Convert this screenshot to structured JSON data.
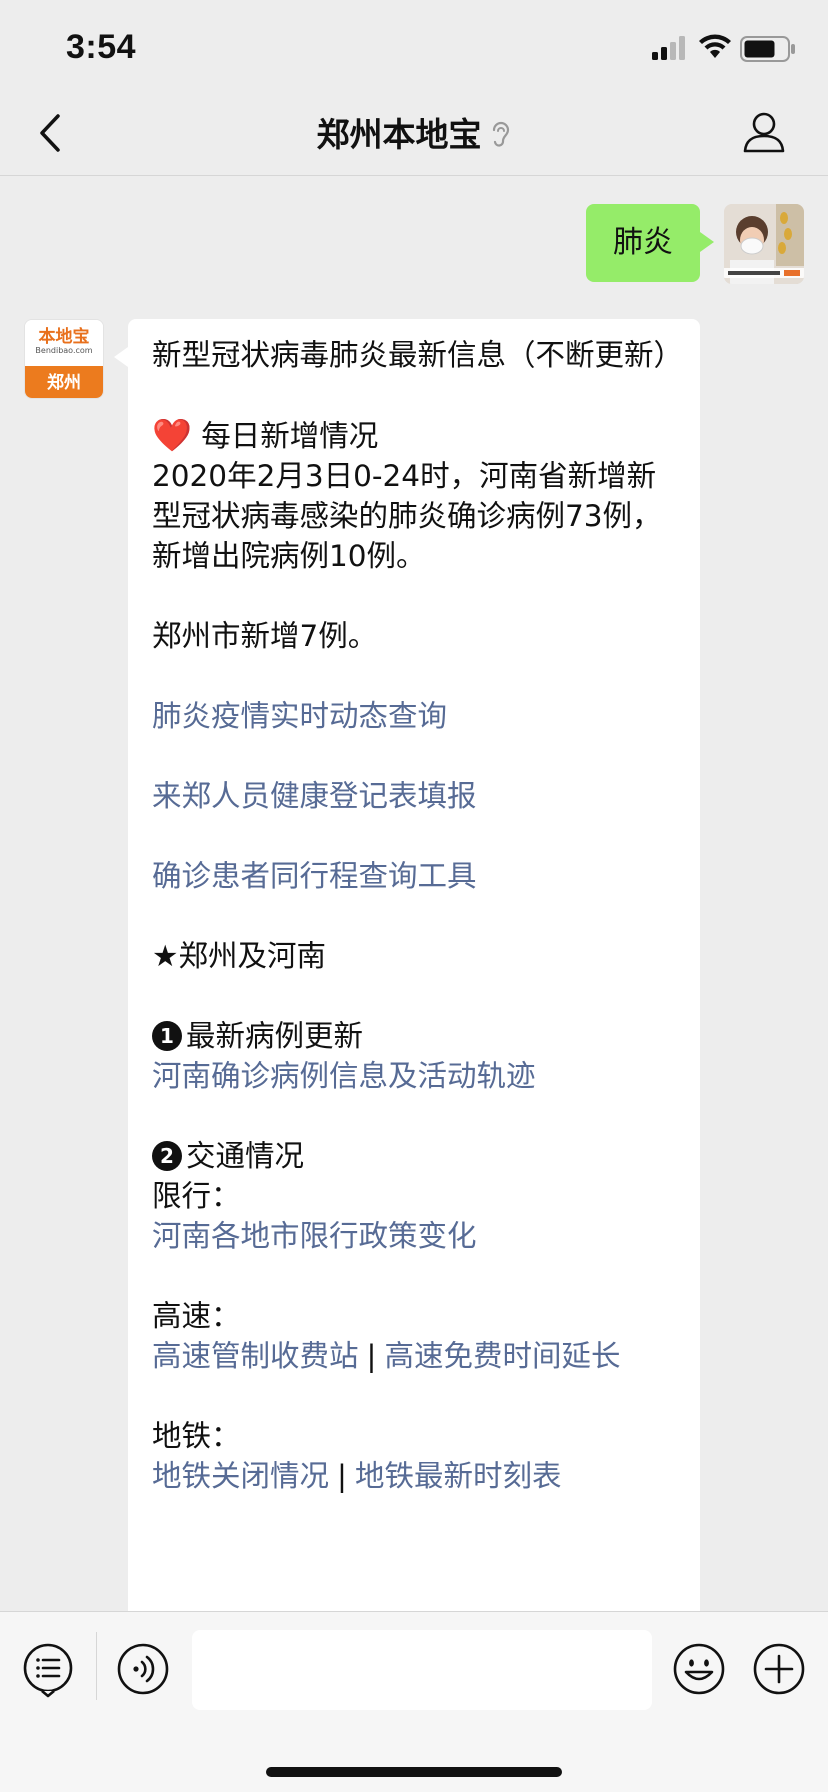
{
  "status_bar": {
    "time": "3:54"
  },
  "nav": {
    "title": "郑州本地宝"
  },
  "messages": {
    "user_text": "肺炎",
    "bot_avatar": {
      "brand": "本地宝",
      "domain": "Bendibao.com",
      "city": "郑州"
    },
    "bot": {
      "l1": "新型冠状病毒肺炎最新信息（不断更新）",
      "heart": "❤️",
      "l2": "每日新增情况",
      "l3": "2020年2月3日0-24时，河南省新增新型冠状病毒感染的肺炎确诊病例73例，新增出院病例10例。",
      "l4": "郑州市新增7例。",
      "link1": "肺炎疫情实时动态查询",
      "link2": "来郑人员健康登记表填报",
      "link3": "确诊患者同行程查询工具",
      "l5": "★郑州及河南",
      "badge1": "1",
      "l6": "最新病例更新",
      "link4": "河南确诊病例信息及活动轨迹",
      "badge2": "2",
      "l7": "交通情况",
      "l8": "限行：",
      "link5": "河南各地市限行政策变化",
      "l9": "高速：",
      "link6": "高速管制收费站",
      "sep": "|",
      "link7": "高速免费时间延长",
      "l10": "地铁：",
      "link8": "地铁关闭情况",
      "link9": "地铁最新时刻表"
    }
  },
  "input": {
    "value": "",
    "placeholder": ""
  }
}
